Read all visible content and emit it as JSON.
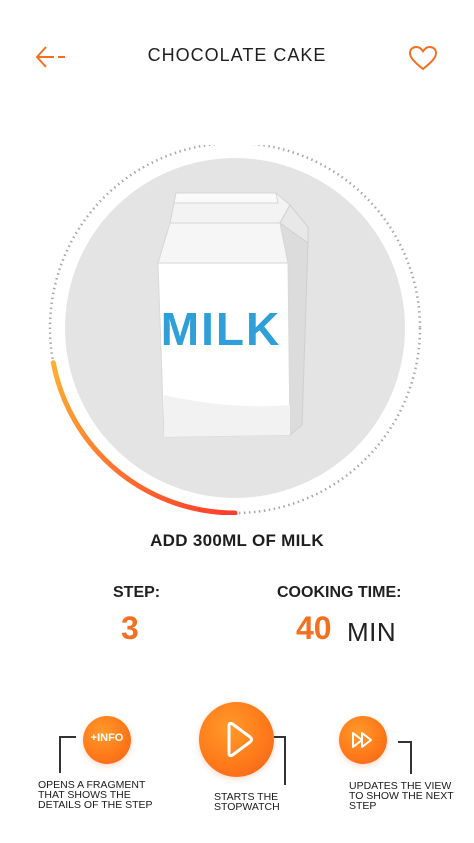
{
  "header": {
    "title": "CHOCOLATE CAKE",
    "back_icon": "arrow-left-icon",
    "favorite_icon": "heart-icon",
    "accent_color": "#f37021"
  },
  "illustration": {
    "label": "MILK",
    "icon": "milk-carton-icon",
    "progress": 0.22
  },
  "step_instruction": "ADD 300ML OF MILK",
  "stats": {
    "step_label": "STEP:",
    "step_value": "3",
    "time_label": "COOKING TIME:",
    "time_value": "40",
    "time_unit": "MIN"
  },
  "actions": {
    "info_label": "+INFO",
    "info_note": "OPENS A FRAGMENT THAT SHOWS THE DETAILS OF THE STEP",
    "play_icon": "play-icon",
    "play_note": "STARTS THE STOPWATCH",
    "next_icon": "fast-forward-icon",
    "next_note": "UPDATES THE VIEW TO SHOW THE NEXT STEP"
  }
}
